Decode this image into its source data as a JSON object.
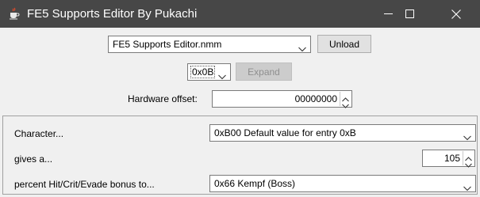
{
  "window": {
    "title": "FE5 Supports Editor By Pukachi"
  },
  "top": {
    "file_combo_value": "FE5 Supports Editor.nmm",
    "unload_label": "Unload",
    "index_combo_value": "0x0B",
    "expand_label": "Expand",
    "hardware_offset_label": "Hardware offset:",
    "hardware_offset_value": "00000000"
  },
  "form": {
    "character_label": "Character...",
    "character_value": "0xB00 Default value for entry 0xB",
    "gives_label": "gives a...",
    "gives_value": "105",
    "bonus_label": "percent Hit/Crit/Evade bonus to...",
    "bonus_value": "0x66 Kempf (Boss)"
  }
}
